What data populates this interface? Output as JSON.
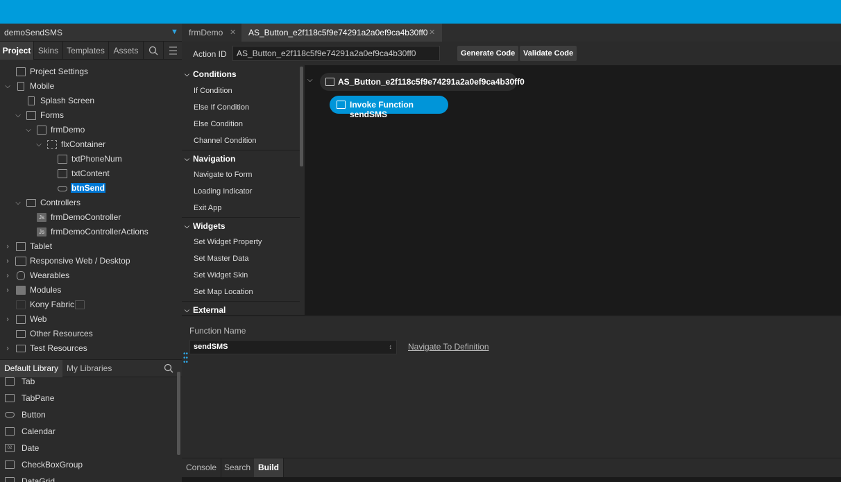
{
  "project": {
    "name": "demoSendSMS"
  },
  "project_tabs": [
    {
      "label": "Project"
    },
    {
      "label": "Skins"
    },
    {
      "label": "Templates"
    },
    {
      "label": "Assets"
    }
  ],
  "tree": [
    {
      "label": "Project Settings"
    },
    {
      "label": "Mobile"
    },
    {
      "label": "Splash Screen"
    },
    {
      "label": "Forms"
    },
    {
      "label": "frmDemo"
    },
    {
      "label": "flxContainer"
    },
    {
      "label": "txtPhoneNum"
    },
    {
      "label": "txtContent"
    },
    {
      "label": "btnSend"
    },
    {
      "label": "Controllers"
    },
    {
      "label": "frmDemoController",
      "icon_text": "Js"
    },
    {
      "label": "frmDemoControllerActions",
      "icon_text": "Js"
    },
    {
      "label": "Tablet"
    },
    {
      "label": "Responsive Web / Desktop"
    },
    {
      "label": "Wearables"
    },
    {
      "label": "Modules"
    },
    {
      "label": "Kony Fabric"
    },
    {
      "label": "Web"
    },
    {
      "label": "Other Resources"
    },
    {
      "label": "Test Resources"
    }
  ],
  "library": {
    "tabs": [
      {
        "label": "Default Library"
      },
      {
        "label": "My Libraries"
      }
    ],
    "items": [
      {
        "label": "Tab"
      },
      {
        "label": "TabPane"
      },
      {
        "label": "Button"
      },
      {
        "label": "Calendar"
      },
      {
        "label": "Date",
        "icon_text": "02"
      },
      {
        "label": "CheckBoxGroup"
      },
      {
        "label": "DataGrid"
      }
    ]
  },
  "doc_tabs": [
    {
      "label": "frmDemo"
    },
    {
      "label": "AS_Button_e2f118c5f9e74291a2a0ef9ca4b30ff0"
    }
  ],
  "action": {
    "id_label": "Action ID",
    "id_value": "AS_Button_e2f118c5f9e74291a2a0ef9ca4b30ff0",
    "generate_label": "Generate Code",
    "validate_label": "Validate Code"
  },
  "palette": {
    "categories": [
      {
        "label": "Conditions",
        "items": [
          "If Condition",
          "Else If Condition",
          "Else Condition",
          "Channel Condition"
        ]
      },
      {
        "label": "Navigation",
        "items": [
          "Navigate to Form",
          "Loading Indicator",
          "Exit App"
        ]
      },
      {
        "label": "Widgets",
        "items": [
          "Set Widget Property",
          "Set Master Data",
          "Set Widget Skin",
          "Set Map Location"
        ]
      },
      {
        "label": "External",
        "items": []
      }
    ]
  },
  "canvas": {
    "event_label": "AS_Button_e2f118c5f9e74291a2a0ef9ca4b30ff0",
    "invoke_label": "Invoke Function sendSMS"
  },
  "properties": {
    "function_name_label": "Function Name",
    "function_name_value": "sendSMS",
    "navigate_link": "Navigate To Definition"
  },
  "bottom_tabs": [
    {
      "label": "Console"
    },
    {
      "label": "Search"
    },
    {
      "label": "Build"
    }
  ],
  "colors": {
    "accent": "#009cdc",
    "selection": "#0078d4",
    "node": "#0095d9"
  }
}
